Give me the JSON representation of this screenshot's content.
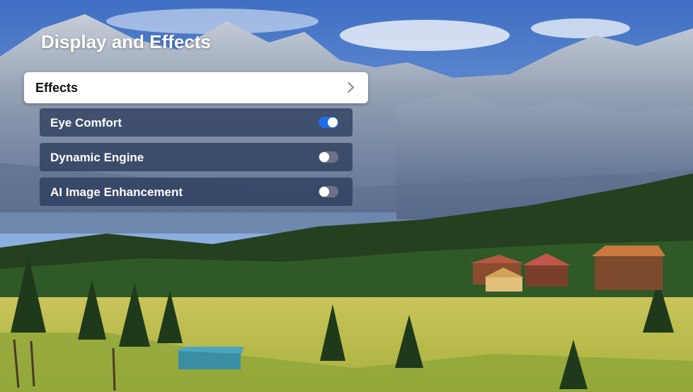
{
  "screen": {
    "title": "Display and Effects"
  },
  "menu": {
    "effects": {
      "label": "Effects",
      "icon": "chevron-right-icon"
    },
    "options": [
      {
        "label": "Eye Comfort",
        "enabled": true
      },
      {
        "label": "Dynamic Engine",
        "enabled": false
      },
      {
        "label": "AI Image Enhancement",
        "enabled": false
      }
    ]
  },
  "colors": {
    "toggle_on": "#1f6fe8",
    "row_background": "#2c3c5c",
    "selected_row": "#ffffff"
  }
}
